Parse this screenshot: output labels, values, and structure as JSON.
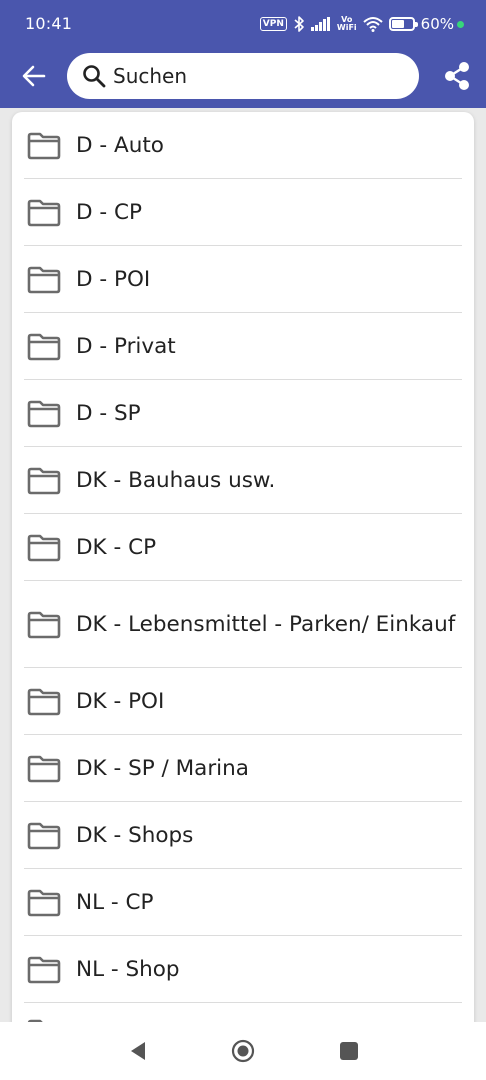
{
  "status_bar": {
    "time": "10:41",
    "vpn": "VPN",
    "vowifi_top": "Vo",
    "vowifi_bottom": "WiFi",
    "battery_level": 0.6,
    "battery_text": "60%"
  },
  "search": {
    "placeholder": "Suchen"
  },
  "folders": [
    {
      "label": "D - Auto"
    },
    {
      "label": "D - CP"
    },
    {
      "label": "D - POI"
    },
    {
      "label": "D - Privat"
    },
    {
      "label": "D - SP"
    },
    {
      "label": "DK - Bauhaus usw."
    },
    {
      "label": "DK - CP"
    },
    {
      "label": "DK - Lebensmittel - Parken/ Einkauf"
    },
    {
      "label": "DK - POI"
    },
    {
      "label": "DK - SP / Marina"
    },
    {
      "label": "DK - Shops"
    },
    {
      "label": "NL - CP"
    },
    {
      "label": "NL - Shop"
    }
  ],
  "colors": {
    "app_bar": "#4a56ad",
    "folder_icon": "#6b6b6b",
    "background": "#e9e9e9"
  },
  "icons": {
    "back": "arrow-left-icon",
    "search": "search-icon",
    "share": "share-icon",
    "folder": "folder-icon"
  }
}
